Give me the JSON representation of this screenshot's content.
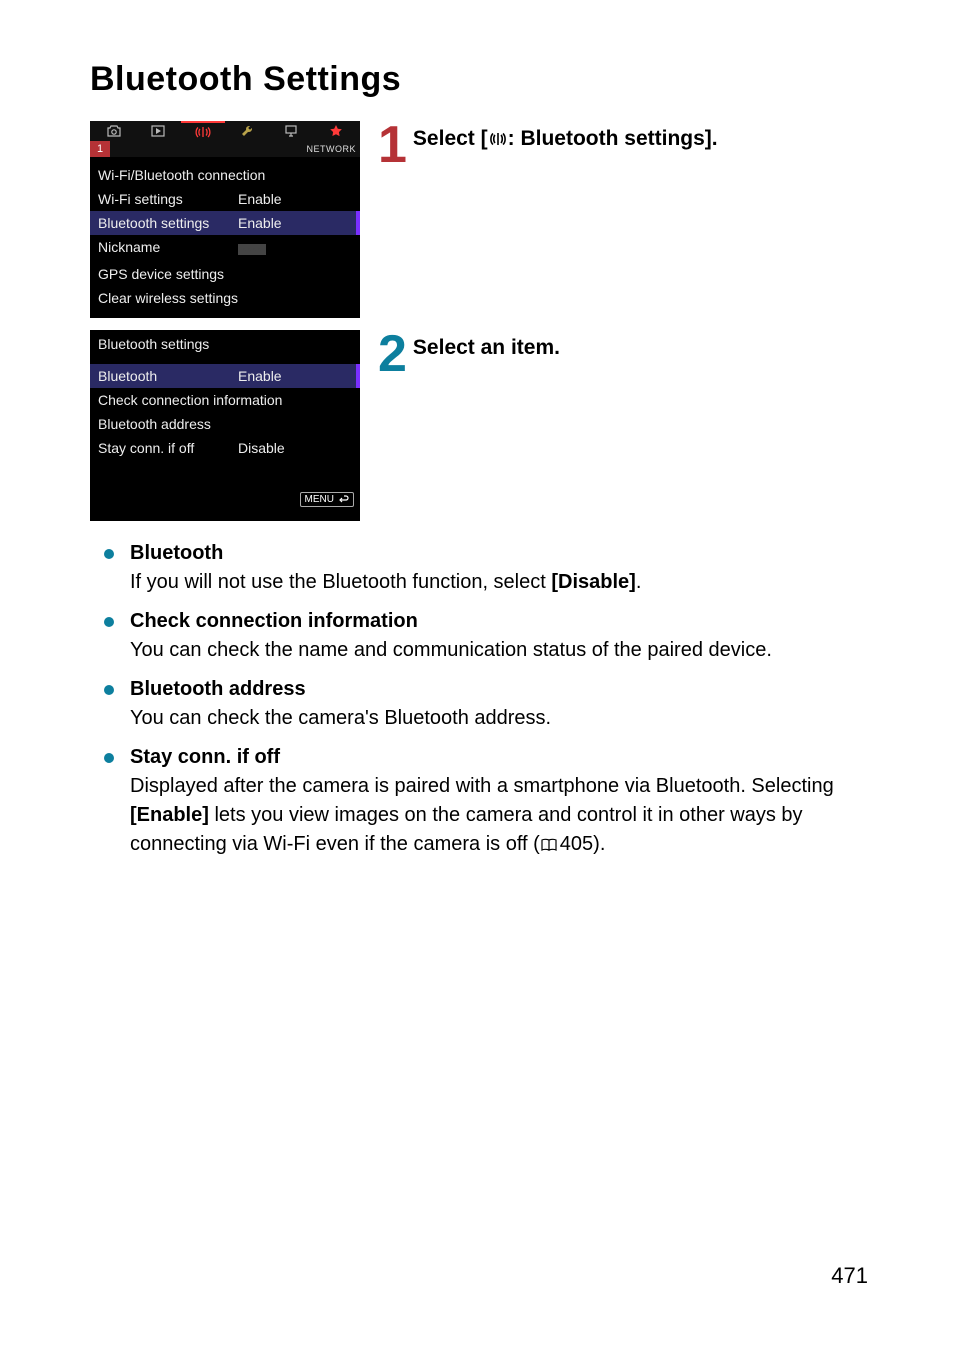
{
  "page": {
    "title": "Bluetooth Settings",
    "number": "471"
  },
  "screen1": {
    "subtabNum": "1",
    "subtabRight": "NETWORK",
    "rows": [
      {
        "label": "Wi-Fi/Bluetooth connection",
        "val": ""
      },
      {
        "label": "Wi-Fi settings",
        "val": "Enable"
      },
      {
        "label": "Bluetooth settings",
        "val": "Enable"
      },
      {
        "label": "Nickname",
        "val": ""
      },
      {
        "label": "GPS device settings",
        "val": ""
      },
      {
        "label": "Clear wireless settings",
        "val": ""
      }
    ],
    "highlightIndex": 2
  },
  "screen2": {
    "header": "Bluetooth settings",
    "rows": [
      {
        "label": "Bluetooth",
        "val": "Enable"
      },
      {
        "label": "Check connection information",
        "val": ""
      },
      {
        "label": "Bluetooth address",
        "val": ""
      },
      {
        "label": "Stay conn. if off",
        "val": "Disable"
      }
    ],
    "highlightIndex": 0,
    "menuLabel": "MENU"
  },
  "steps": {
    "s1_prefix": "Select [",
    "s1_suffix": ": Bluetooth settings].",
    "s2": "Select an item."
  },
  "bullets": {
    "b1h": "Bluetooth",
    "b1d_a": "If you will not use the Bluetooth function, select ",
    "b1d_b": "[Disable]",
    "b1d_c": ".",
    "b2h": "Check connection information",
    "b2d": "You can check the name and communication status of the paired device.",
    "b3h": "Bluetooth address",
    "b3d": "You can check the camera's Bluetooth address.",
    "b4h": "Stay conn. if off",
    "b4d_a": "Displayed after the camera is paired with a smartphone via Bluetooth. Selecting ",
    "b4d_b": "[Enable]",
    "b4d_c": " lets you view images on the camera and control it in other ways by connecting via Wi-Fi even if the camera is off (",
    "b4d_pref": "405).",
    "book_icon_label": "page-reference-icon"
  }
}
